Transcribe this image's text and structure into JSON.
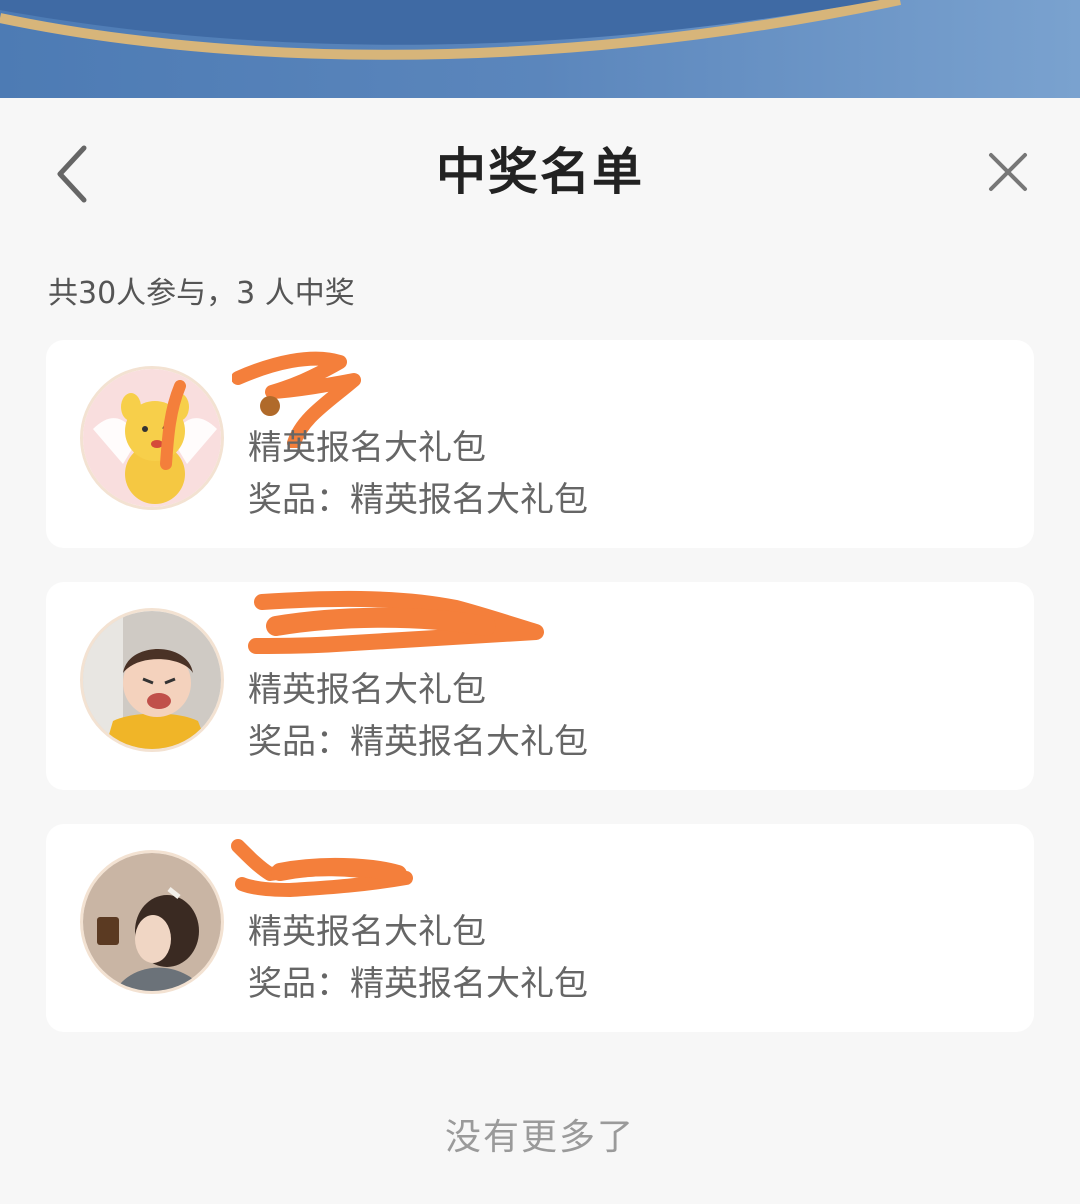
{
  "header": {
    "title": "中奖名单"
  },
  "summary_text": "共30人参与，3 人中奖",
  "winners": [
    {
      "nickname": "",
      "prize_package": "精英报名大礼包",
      "prize_label": "奖品：精英报名大礼包"
    },
    {
      "nickname": "",
      "prize_package": "精英报名大礼包",
      "prize_label": "奖品：精英报名大礼包"
    },
    {
      "nickname": "",
      "prize_package": "精英报名大礼包",
      "prize_label": "奖品：精英报名大礼包"
    }
  ],
  "footer": {
    "no_more": "没有更多了"
  },
  "icons": {
    "back": "chevron-left-icon",
    "close": "close-icon"
  },
  "colors": {
    "banner": "#5b86bc",
    "redaction": "#f47f3b"
  }
}
